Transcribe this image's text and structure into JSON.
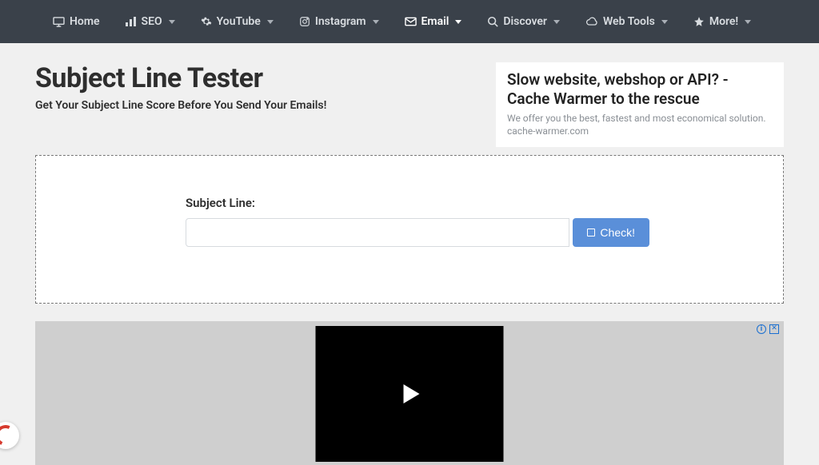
{
  "nav": {
    "home": "Home",
    "seo": "SEO",
    "youtube": "YouTube",
    "instagram": "Instagram",
    "email": "Email",
    "discover": "Discover",
    "webtools": "Web Tools",
    "more": "More!"
  },
  "page": {
    "title": "Subject Line Tester",
    "subtitle": "Get Your Subject Line Score Before You Send Your Emails!"
  },
  "sidebar_ad": {
    "title": "Slow website, webshop or API? - Cache Warmer to the rescue",
    "desc": "We offer you the best, fastest and most economical solution. cache-warmer.com"
  },
  "form": {
    "label": "Subject Line:",
    "value": "",
    "placeholder": "",
    "button": "Check!"
  },
  "bottom_ad": {
    "close": "✕",
    "info": "i"
  }
}
